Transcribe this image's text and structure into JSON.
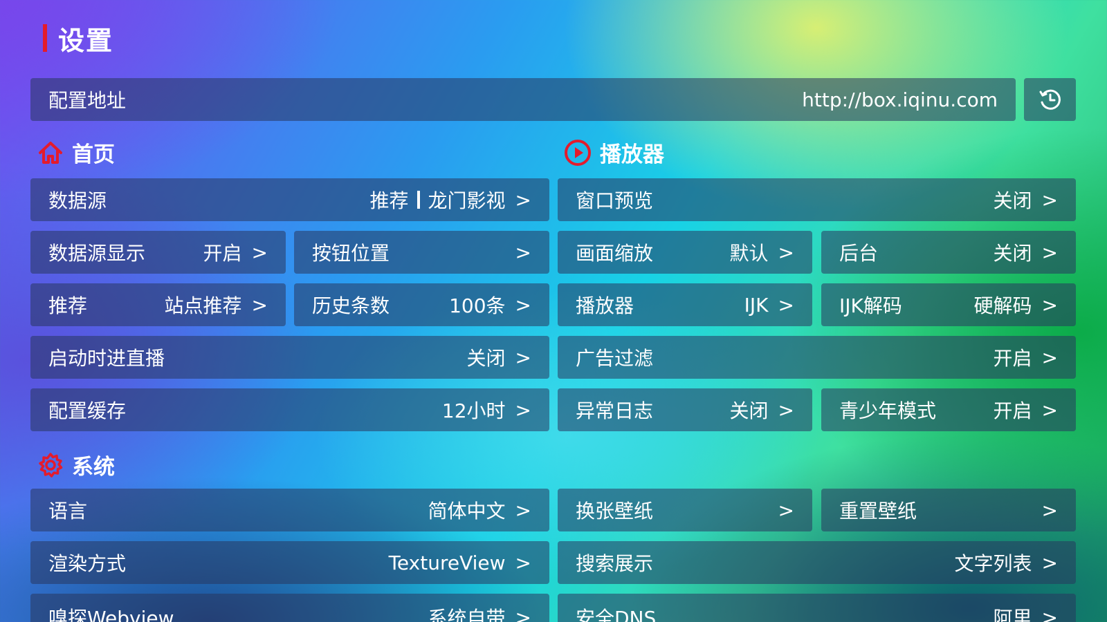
{
  "page_title": "设置",
  "config": {
    "label": "配置地址",
    "value": "http://box.iqinu.com"
  },
  "chevron": ">",
  "sections": {
    "home": "首页",
    "player": "播放器",
    "system": "系统"
  },
  "home": {
    "source": {
      "label": "数据源",
      "value_a": "推荐",
      "value_b": "龙门影视"
    },
    "source_display": {
      "label": "数据源显示",
      "value": "开启"
    },
    "button_position": {
      "label": "按钮位置",
      "value": ""
    },
    "recommend": {
      "label": "推荐",
      "value": "站点推荐"
    },
    "history_count": {
      "label": "历史条数",
      "value": "100条"
    },
    "startup_live": {
      "label": "启动时进直播",
      "value": "关闭"
    },
    "config_cache": {
      "label": "配置缓存",
      "value": "12小时"
    }
  },
  "player": {
    "window_preview": {
      "label": "窗口预览",
      "value": "关闭"
    },
    "scaling": {
      "label": "画面缩放",
      "value": "默认"
    },
    "background": {
      "label": "后台",
      "value": "关闭"
    },
    "player": {
      "label": "播放器",
      "value": "IJK"
    },
    "ijk_decode": {
      "label": "IJK解码",
      "value": "硬解码"
    },
    "ad_filter": {
      "label": "广告过滤",
      "value": "开启"
    },
    "error_log": {
      "label": "异常日志",
      "value": "关闭"
    },
    "teen_mode": {
      "label": "青少年模式",
      "value": "开启"
    }
  },
  "system": {
    "language": {
      "label": "语言",
      "value": "简体中文"
    },
    "change_wallpaper": {
      "label": "换张壁纸",
      "value": ""
    },
    "reset_wallpaper": {
      "label": "重置壁纸",
      "value": ""
    },
    "render_mode": {
      "label": "渲染方式",
      "value": "TextureView"
    },
    "search_display": {
      "label": "搜索展示",
      "value": "文字列表"
    },
    "sniff_webview": {
      "label": "嗅探Webview",
      "value": "系统自带"
    },
    "secure_dns": {
      "label": "安全DNS",
      "value": "阿里"
    }
  },
  "colors": {
    "accent": "#e41b2c",
    "row_bg": "rgba(40,55,95,0.55)"
  },
  "icons": {
    "reset": "history-icon",
    "home": "home-icon",
    "player": "play-circle-icon",
    "system": "gear-icon"
  }
}
